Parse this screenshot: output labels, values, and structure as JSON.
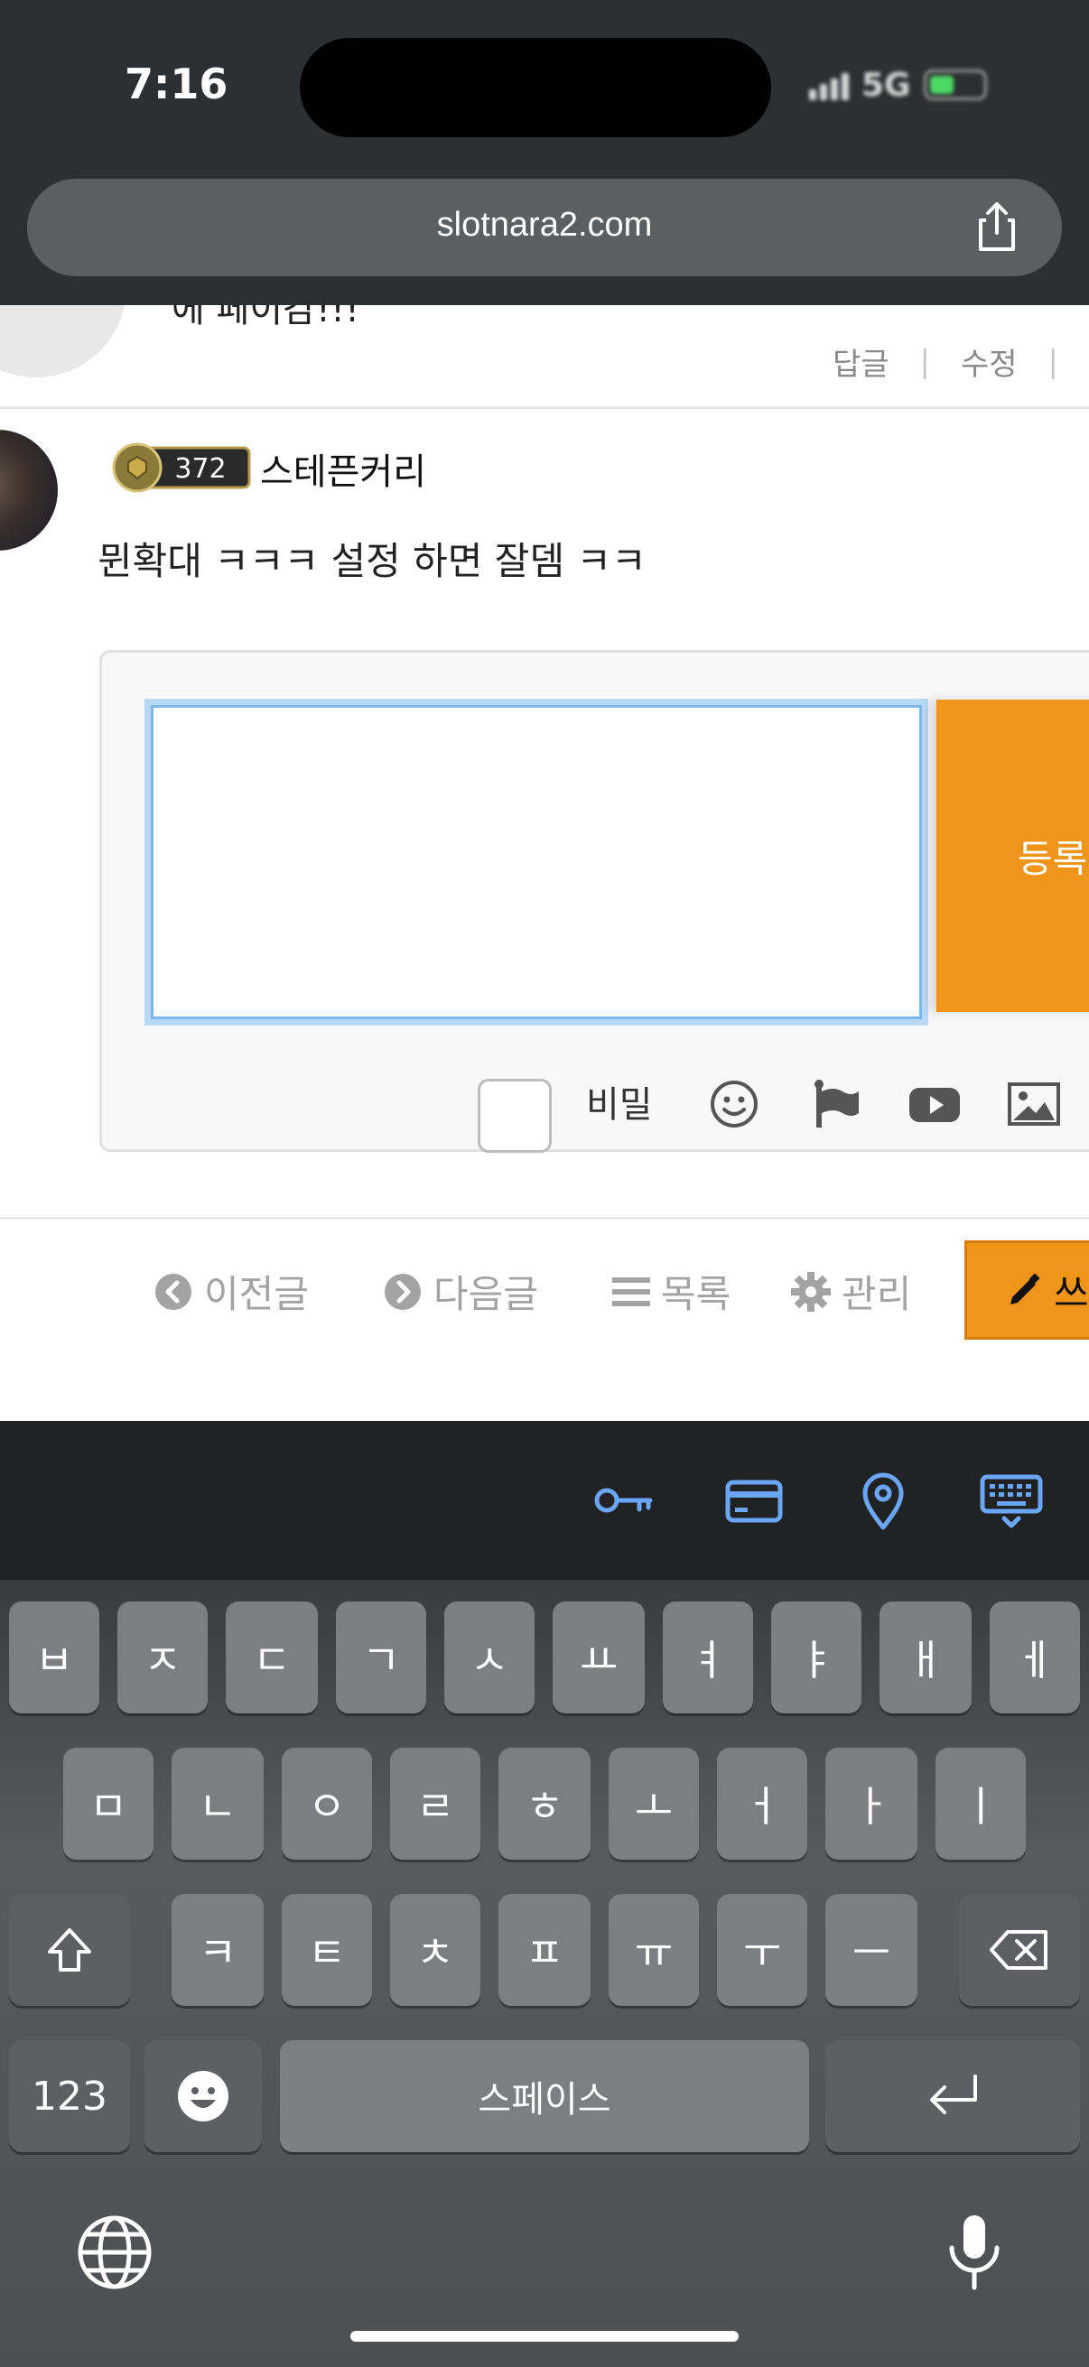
{
  "status_bar": {
    "time": "7:16",
    "network": "5G"
  },
  "browser": {
    "url": "slotnara2.com"
  },
  "prev_comment": {
    "text": "에 페이감!!!",
    "reply_label": "답글",
    "edit_label": "수정"
  },
  "comment": {
    "level": "372",
    "username": "스테픈커리",
    "text": "뮌확대 ㅋㅋㅋ 설정 하면 잘뎀 ㅋㅋ"
  },
  "reply_form": {
    "submit_label": "등록",
    "secret_label": "비밀"
  },
  "nav": {
    "prev": "이전글",
    "next": "다음글",
    "list": "목록",
    "manage": "관리",
    "write": "쓰"
  },
  "keyboard": {
    "row1": [
      "ㅂ",
      "ㅈ",
      "ㄷ",
      "ㄱ",
      "ㅅ",
      "ㅛ",
      "ㅕ",
      "ㅑ",
      "ㅐ",
      "ㅔ"
    ],
    "row2": [
      "ㅁ",
      "ㄴ",
      "ㅇ",
      "ㄹ",
      "ㅎ",
      "ㅗ",
      "ㅓ",
      "ㅏ",
      "ㅣ"
    ],
    "row3": [
      "ㅋ",
      "ㅌ",
      "ㅊ",
      "ㅍ",
      "ㅠ",
      "ㅜ",
      "ㅡ"
    ],
    "numbers_label": "123",
    "space_label": "스페이스"
  },
  "colors": {
    "accent": "#f0951a",
    "link_blue": "#6aa6f5"
  }
}
